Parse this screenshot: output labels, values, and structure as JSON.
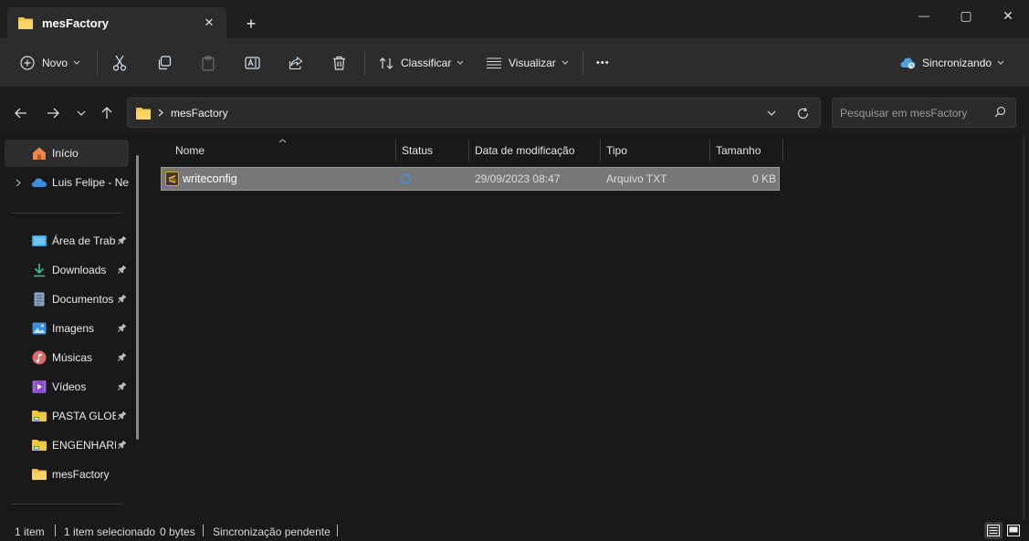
{
  "tab": {
    "title": "mesFactory",
    "close_symbol": "✕",
    "new_tab_symbol": "+"
  },
  "window": {
    "minimize": "—",
    "maximize": "▢",
    "close": "✕"
  },
  "toolbar": {
    "new_label": "Novo",
    "sort_label": "Classificar",
    "view_label": "Visualizar",
    "more_symbol": "•••",
    "sync_label": "Sincronizando"
  },
  "address": {
    "breadcrumb": [
      "mesFactory"
    ],
    "search_placeholder": "Pesquisar em mesFactory"
  },
  "sidebar": {
    "items": [
      {
        "label": "Início",
        "icon": "home-icon"
      },
      {
        "label": "Luis Felipe - Nev",
        "icon": "onedrive-icon"
      },
      {
        "label": "Área de Trabalho",
        "icon": "desktop-icon",
        "pinned": true
      },
      {
        "label": "Downloads",
        "icon": "download-icon",
        "pinned": true
      },
      {
        "label": "Documentos",
        "icon": "documents-icon",
        "pinned": true
      },
      {
        "label": "Imagens",
        "icon": "pictures-icon",
        "pinned": true
      },
      {
        "label": "Músicas",
        "icon": "music-icon",
        "pinned": true
      },
      {
        "label": "Vídeos",
        "icon": "videos-icon",
        "pinned": true
      },
      {
        "label": "PASTA GLOBAL",
        "icon": "network-folder-icon",
        "pinned": true
      },
      {
        "label": "ENGENHARIA",
        "icon": "network-folder-icon",
        "pinned": true
      },
      {
        "label": "mesFactory",
        "icon": "folder-icon"
      }
    ]
  },
  "table": {
    "columns": [
      "Nome",
      "Status",
      "Data de modificação",
      "Tipo",
      "Tamanho"
    ],
    "rows": [
      {
        "name": "writeconfig",
        "status": "sync-pending-icon",
        "modified": "29/09/2023 08:47",
        "type": "Arquivo TXT",
        "size": "0 KB"
      }
    ]
  },
  "status": {
    "count": "1 item",
    "selected": "1 item selecionado",
    "bytes": "0 bytes",
    "sync": "Sincronização pendente"
  },
  "colors": {
    "folder": "#f4c542",
    "accent": "#4aa3df",
    "selection": "#777777"
  }
}
